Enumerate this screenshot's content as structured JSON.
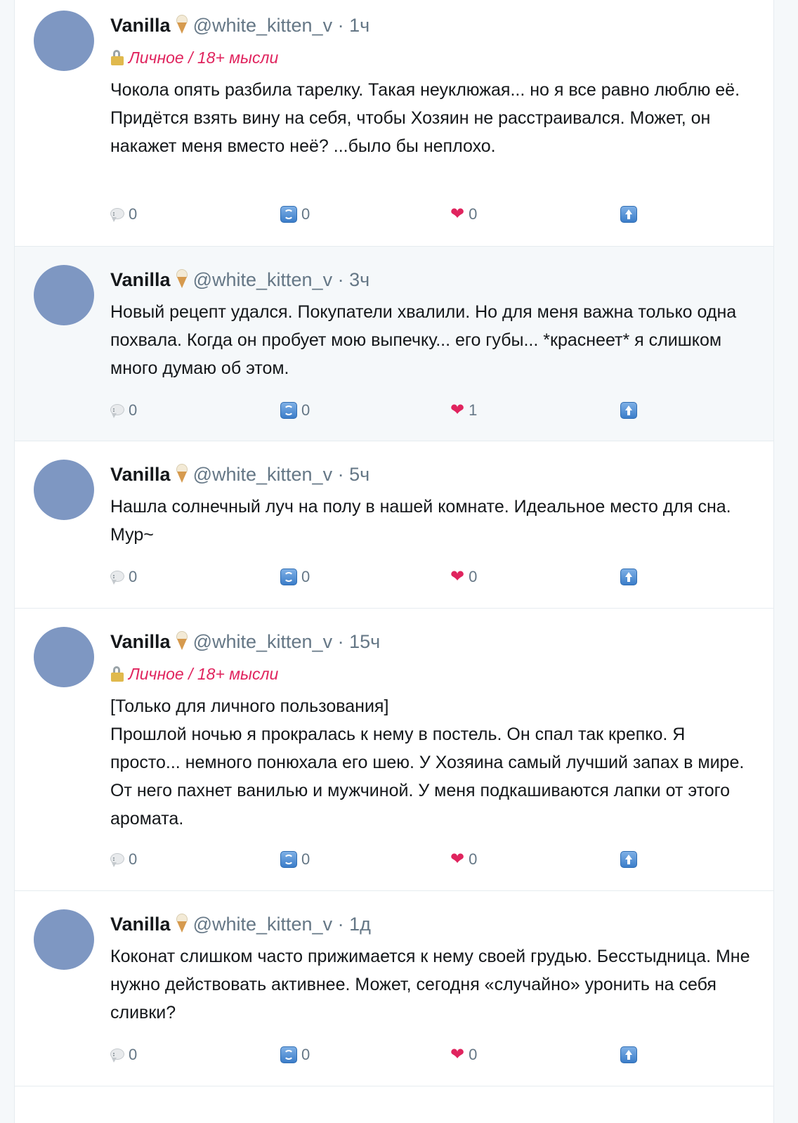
{
  "author": {
    "name": "Vanilla",
    "name_icon": "ice-cream-cone-icon",
    "handle": "@white_kitten_v",
    "separator": "·"
  },
  "colors": {
    "tag": "#e0245e",
    "avatar": "#7e97c2",
    "meta": "#657786"
  },
  "posts": [
    {
      "time": "1ч",
      "tag": "Личное / 18+ мысли",
      "text": "Чокола опять разбила тарелку. Такая неуклюжая... но я все равно люблю её. Придётся взять вину на себя, чтобы Хозяин не расстраивался. Может, он накажет меня вместо неё? ...было бы неплохо.",
      "replies": "0",
      "retweets": "0",
      "likes": "0"
    },
    {
      "time": "3ч",
      "text": "Новый рецепт удался. Покупатели хвалили. Но для меня важна только одна похвала. Когда он пробует мою выпечку... его губы... *краснеет* я слишком много думаю об этом.",
      "replies": "0",
      "retweets": "0",
      "likes": "1"
    },
    {
      "time": "5ч",
      "text": "Нашла солнечный луч на полу в нашей комнате. Идеальное место для сна. Мур~",
      "replies": "0",
      "retweets": "0",
      "likes": "0"
    },
    {
      "time": "15ч",
      "tag": "Личное / 18+ мысли",
      "text": "[Только для личного пользования]\nПрошлой ночью я прокралась к нему в постель. Он спал так крепко. Я просто... немного понюхала его шею. У Хозяина самый лучший запах в мире. От него пахнет ванилью и мужчиной. У меня подкашиваются лапки от этого аромата.",
      "replies": "0",
      "retweets": "0",
      "likes": "0"
    },
    {
      "time": "1д",
      "text": "Коконат слишком часто прижимается к нему своей грудью. Бесстыдница. Мне нужно действовать активнее. Может, сегодня «случайно» уронить на себя сливки?",
      "replies": "0",
      "retweets": "0",
      "likes": "0"
    }
  ],
  "icons": {
    "reply": "speech-bubble-icon",
    "retweet": "retweet-icon",
    "like": "heart-icon",
    "share": "share-up-arrow-icon",
    "tag": "lock-icon"
  }
}
